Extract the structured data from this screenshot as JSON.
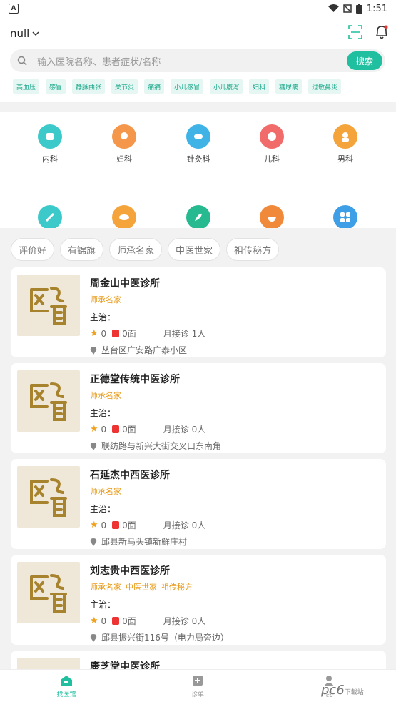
{
  "status": {
    "time": "1:51"
  },
  "header": {
    "city": "null"
  },
  "search": {
    "placeholder": "输入医院名称、患者症状/名称",
    "button": "搜索"
  },
  "tags": [
    "高血压",
    "感冒",
    "静脉曲张",
    "关节炎",
    "痛痛",
    "小儿感冒",
    "小儿腹泻",
    "妇科",
    "糖尿病",
    "过敏鼻炎"
  ],
  "categories": [
    {
      "label": "内科",
      "color": "#3cc9c9"
    },
    {
      "label": "妇科",
      "color": "#f4974a"
    },
    {
      "label": "针灸科",
      "color": "#3fb3e6"
    },
    {
      "label": "儿科",
      "color": "#f26b6b"
    },
    {
      "label": "男科",
      "color": "#f4a43a"
    },
    {
      "label": "",
      "color": "#3cc9c9"
    },
    {
      "label": "",
      "color": "#f4a43a"
    },
    {
      "label": "",
      "color": "#27b98f"
    },
    {
      "label": "",
      "color": "#f08a3a"
    },
    {
      "label": "",
      "color": "#3f9fe6"
    }
  ],
  "filters": [
    "评价好",
    "有锦旗",
    "师承名家",
    "中医世家",
    "祖传秘方"
  ],
  "clinics": [
    {
      "name": "周金山中医诊所",
      "badges": [
        "师承名家"
      ],
      "main": "主治：",
      "rating": "0",
      "flags": "0面",
      "monthly": "月接诊 1人",
      "address": "丛台区广安路广泰小区"
    },
    {
      "name": "正德堂传统中医诊所",
      "badges": [
        "师承名家"
      ],
      "main": "主治：",
      "rating": "0",
      "flags": "0面",
      "monthly": "月接诊 0人",
      "address": "联纺路与新兴大街交叉口东南角"
    },
    {
      "name": "石延杰中西医诊所",
      "badges": [
        "师承名家"
      ],
      "main": "主治：",
      "rating": "0",
      "flags": "0面",
      "monthly": "月接诊 0人",
      "address": "邱县新马头镇新鲜庄村"
    },
    {
      "name": "刘志贵中西医诊所",
      "badges": [
        "师承名家",
        "中医世家",
        "祖传秘方"
      ],
      "main": "主治：",
      "rating": "0",
      "flags": "0面",
      "monthly": "月接诊 0人",
      "address": "邱县振兴街116号（电力局旁边）"
    },
    {
      "name": "康芝堂中医诊所",
      "badges": [],
      "main": "",
      "rating": "",
      "flags": "",
      "monthly": "",
      "address": ""
    }
  ],
  "tabs": [
    {
      "label": "找医馆",
      "active": true
    },
    {
      "label": "诊单",
      "active": false
    },
    {
      "label": "我",
      "active": false
    }
  ],
  "watermark": {
    "text": "pc6",
    "sub": "下载站"
  }
}
